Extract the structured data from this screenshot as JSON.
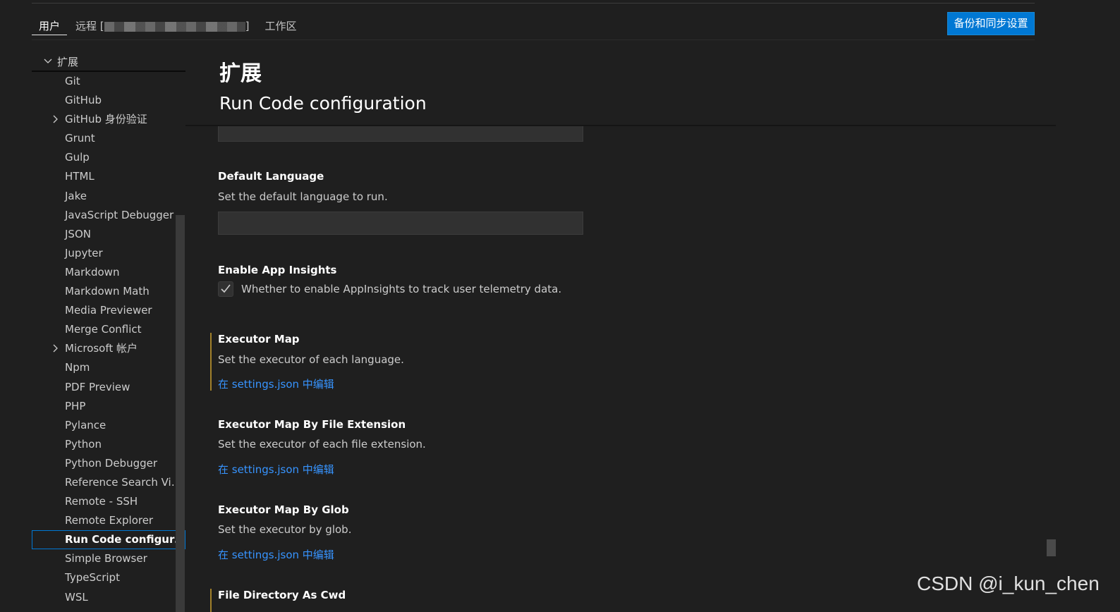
{
  "tabs": {
    "user": "用户",
    "remote_prefix": "远程 [",
    "remote_suffix": "]",
    "workspace": "工作区"
  },
  "sync_button": "备份和同步设置",
  "tree": {
    "header": "扩展",
    "items": [
      {
        "label": "Git",
        "expandable": false
      },
      {
        "label": "GitHub",
        "expandable": false
      },
      {
        "label": "GitHub 身份验证",
        "expandable": true
      },
      {
        "label": "Grunt",
        "expandable": false
      },
      {
        "label": "Gulp",
        "expandable": false
      },
      {
        "label": "HTML",
        "expandable": false
      },
      {
        "label": "Jake",
        "expandable": false
      },
      {
        "label": "JavaScript Debugger",
        "expandable": false
      },
      {
        "label": "JSON",
        "expandable": false
      },
      {
        "label": "Jupyter",
        "expandable": false
      },
      {
        "label": "Markdown",
        "expandable": false
      },
      {
        "label": "Markdown Math",
        "expandable": false
      },
      {
        "label": "Media Previewer",
        "expandable": false
      },
      {
        "label": "Merge Conflict",
        "expandable": false
      },
      {
        "label": "Microsoft 帐户",
        "expandable": true
      },
      {
        "label": "Npm",
        "expandable": false
      },
      {
        "label": "PDF Preview",
        "expandable": false
      },
      {
        "label": "PHP",
        "expandable": false
      },
      {
        "label": "Pylance",
        "expandable": false
      },
      {
        "label": "Python",
        "expandable": false
      },
      {
        "label": "Python Debugger",
        "expandable": false
      },
      {
        "label": "Reference Search View",
        "expandable": false
      },
      {
        "label": "Remote - SSH",
        "expandable": false
      },
      {
        "label": "Remote Explorer",
        "expandable": false
      },
      {
        "label": "Run Code configura...",
        "expandable": false,
        "selected": true
      },
      {
        "label": "Simple Browser",
        "expandable": false
      },
      {
        "label": "TypeScript",
        "expandable": false
      },
      {
        "label": "WSL",
        "expandable": false
      }
    ]
  },
  "content": {
    "page_title": "扩展",
    "section_title": "Run Code configuration",
    "default_language": {
      "title": "Default Language",
      "description": "Set the default language to run.",
      "value": ""
    },
    "app_insights": {
      "title": "Enable App Insights",
      "description": "Whether to enable AppInsights to track user telemetry data.",
      "checked": true
    },
    "executor_map": {
      "title": "Executor Map",
      "description": "Set the executor of each language.",
      "link": "在 settings.json 中编辑"
    },
    "executor_map_ext": {
      "title": "Executor Map By File Extension",
      "description": "Set the executor of each file extension.",
      "link": "在 settings.json 中编辑"
    },
    "executor_map_glob": {
      "title": "Executor Map By Glob",
      "description": "Set the executor by glob.",
      "link": "在 settings.json 中编辑"
    },
    "file_dir_cwd": {
      "title": "File Directory As Cwd"
    }
  },
  "watermark": "CSDN @i_kun_chen",
  "colors": {
    "background": "#1f1f1f",
    "accent": "#0078d4",
    "link": "#3794ff",
    "modified": "#a1802a"
  }
}
